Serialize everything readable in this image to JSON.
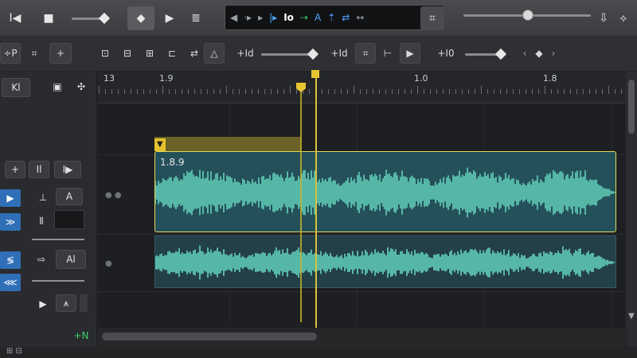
{
  "transport": {
    "play_icon": "play-icon",
    "stop_icon": "stop-icon",
    "record_icon": "record-icon",
    "lcd": {
      "items": [
        "◀",
        "·▸",
        "▸",
        "|▸",
        "Io",
        "⇢",
        "A",
        "⇡",
        "⇄",
        "↔"
      ]
    },
    "right_labels": [
      "⇩",
      "⟡"
    ]
  },
  "toolbar": {
    "left_mode": "÷P",
    "tool_labels": [
      "⌗",
      "+"
    ],
    "right_labels": [
      "+Id",
      "+Id",
      "+I0"
    ],
    "grid_button": "⌗",
    "snap_button": "⊢",
    "zoom_button": "▶"
  },
  "header": {
    "track_name": "Kl",
    "btn_plus": "+",
    "btn_link": "Il",
    "btn_play": "I▶",
    "track1_value": "A",
    "track2_value": "Al",
    "add_label": "+N"
  },
  "ruler": {
    "labels": [
      "13",
      "1.9",
      "1.0",
      "1.8"
    ]
  },
  "regions": [
    {
      "label": "1.8.9"
    },
    {
      "label": ""
    }
  ],
  "colors": {
    "accent": "#e4c22c",
    "wave": "#57b7a7",
    "region_bg": "#24505a",
    "selection": "#2f6fb7"
  }
}
